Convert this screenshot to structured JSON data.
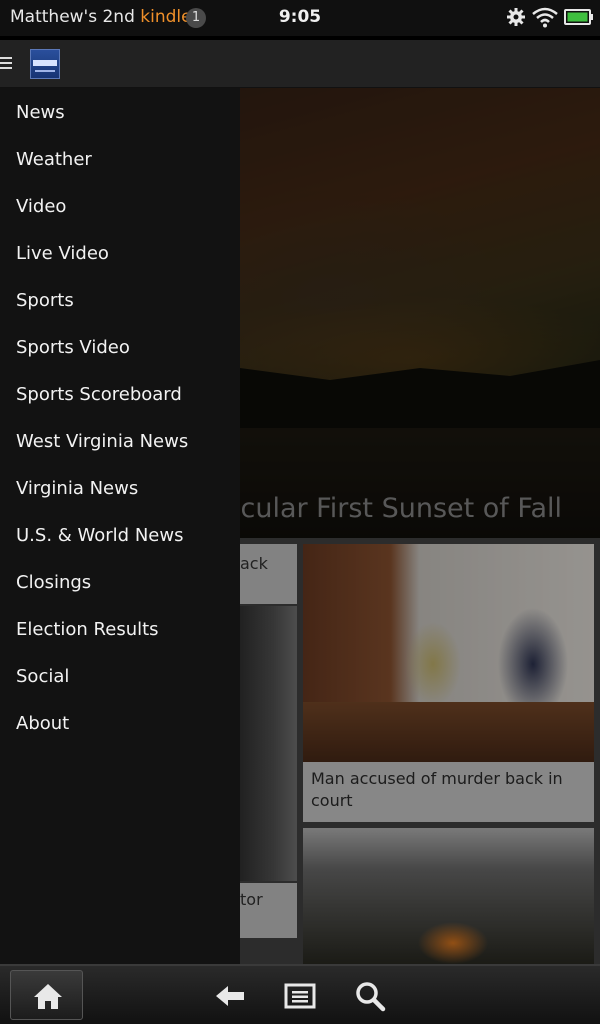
{
  "status_bar": {
    "device_name_prefix": "Matthew's 2nd ",
    "device_name_brand": "kindle",
    "notification_count": "1",
    "time": "9:05",
    "battery_color": "#3fbf3f"
  },
  "app_bar": {
    "logo_icon": "wvva-logo"
  },
  "menu": {
    "items": [
      {
        "label": "News"
      },
      {
        "label": "Weather"
      },
      {
        "label": "Video"
      },
      {
        "label": "Live Video"
      },
      {
        "label": "Sports"
      },
      {
        "label": "Sports Video"
      },
      {
        "label": "Sports Scoreboard"
      },
      {
        "label": "West Virginia News"
      },
      {
        "label": "Virginia News"
      },
      {
        "label": "U.S. & World News"
      },
      {
        "label": "Closings"
      },
      {
        "label": "Election Results"
      },
      {
        "label": "Social"
      },
      {
        "label": "About"
      }
    ]
  },
  "content": {
    "hero_title": "Spectacular First Sunset of Fall",
    "left_card_1_text": "ack",
    "left_card_2_text": "tor",
    "right_card_caption": "Man accused of murder back in court"
  },
  "bottom_nav": {
    "icons": [
      "home-icon",
      "back-icon",
      "menu-list-icon",
      "search-icon"
    ]
  }
}
